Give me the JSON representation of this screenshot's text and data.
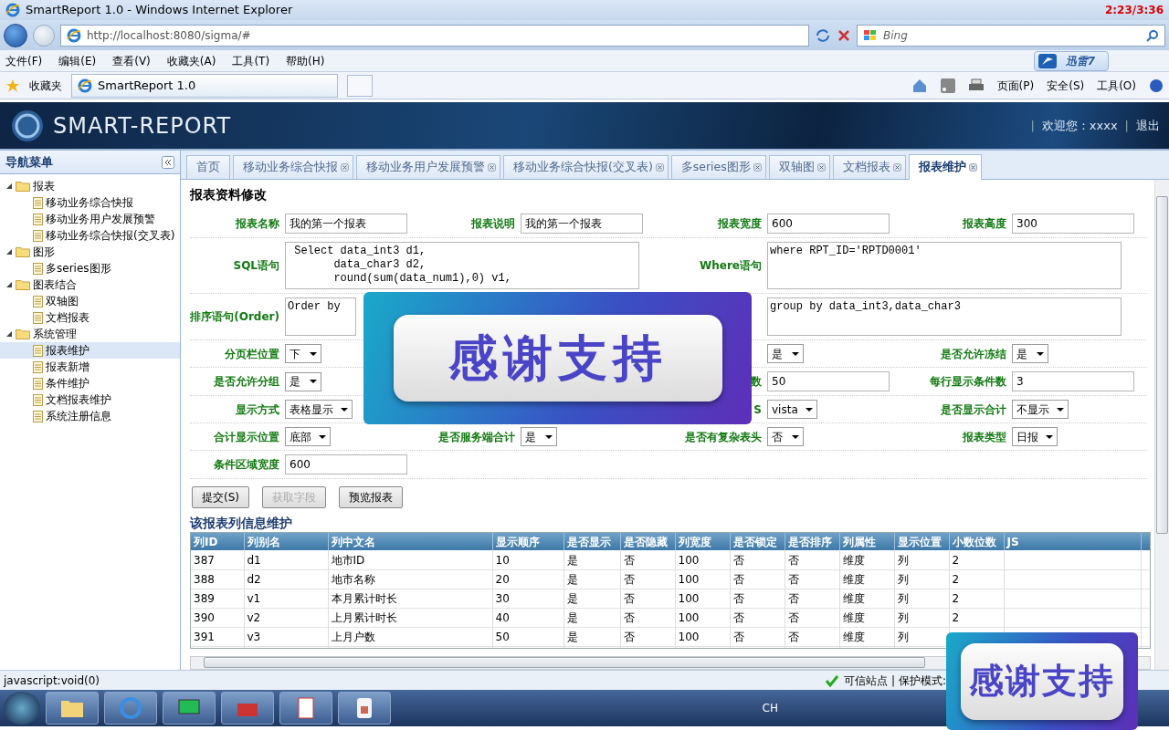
{
  "browser": {
    "title": "SmartReport 1.0 - Windows Internet Explorer",
    "timestamp": "2:23/3:36",
    "address": "http://localhost:8080/sigma/#",
    "search": {
      "placeholder": "Bing"
    },
    "menu": [
      "文件(F)",
      "编辑(E)",
      "查看(V)",
      "收藏夹(A)",
      "工具(T)",
      "帮助(H)"
    ],
    "favorites": "收藏夹",
    "tab": "SmartReport 1.0",
    "addon": "迅雷7",
    "commands": [
      "页面(P)",
      "安全(S)",
      "工具(O)"
    ]
  },
  "app": {
    "logo": "SMART-REPORT",
    "separators": [
      "|",
      "|"
    ],
    "welcome": "欢迎您：xxxx",
    "logout": "退出"
  },
  "sidebar": {
    "title": "导航菜单",
    "items": [
      {
        "label": "报表",
        "kind": "folder",
        "expanded": true,
        "selected": false,
        "children": [
          {
            "label": "移动业务综合快报",
            "kind": "doc",
            "selected": false
          },
          {
            "label": "移动业务用户发展预警",
            "kind": "doc",
            "selected": false
          },
          {
            "label": "移动业务综合快报(交叉表)",
            "kind": "doc",
            "selected": false
          }
        ]
      },
      {
        "label": "图形",
        "kind": "folder",
        "expanded": true,
        "selected": false,
        "children": [
          {
            "label": "多series图形",
            "kind": "doc",
            "selected": false
          }
        ]
      },
      {
        "label": "图表结合",
        "kind": "folder",
        "expanded": true,
        "selected": false,
        "children": [
          {
            "label": "双轴图",
            "kind": "doc",
            "selected": false
          },
          {
            "label": "文档报表",
            "kind": "doc",
            "selected": false
          }
        ]
      },
      {
        "label": "系统管理",
        "kind": "folder",
        "expanded": true,
        "selected": false,
        "children": [
          {
            "label": "报表维护",
            "kind": "doc",
            "selected": true
          },
          {
            "label": "报表新增",
            "kind": "doc",
            "selected": false
          },
          {
            "label": "条件维护",
            "kind": "doc",
            "selected": false
          },
          {
            "label": "文档报表维护",
            "kind": "doc",
            "selected": false
          },
          {
            "label": "系统注册信息",
            "kind": "doc",
            "selected": false
          }
        ]
      }
    ]
  },
  "tabs": [
    {
      "label": "首页",
      "closable": false,
      "selected": false
    },
    {
      "label": "移动业务综合快报",
      "closable": true,
      "selected": false
    },
    {
      "label": "移动业务用户发展预警",
      "closable": true,
      "selected": false
    },
    {
      "label": "移动业务综合快报(交叉表)",
      "closable": true,
      "selected": false
    },
    {
      "label": "多series图形",
      "closable": true,
      "selected": false
    },
    {
      "label": "双轴图",
      "closable": true,
      "selected": false
    },
    {
      "label": "文档报表",
      "closable": true,
      "selected": false
    },
    {
      "label": "报表维护",
      "closable": true,
      "selected": true
    }
  ],
  "form": {
    "title": "报表资料修改",
    "rows": [
      {
        "fields": [
          {
            "label": "报表名称",
            "kind": "text",
            "value": "我的第一个报表"
          },
          {
            "label": "报表说明",
            "kind": "text",
            "value": "我的第一个报表"
          },
          {
            "label": "报表宽度",
            "kind": "text",
            "value": "600"
          },
          {
            "label": "报表高度",
            "kind": "text",
            "value": "300"
          }
        ]
      },
      {
        "fields": [
          {
            "label": "SQL语句",
            "kind": "textarea",
            "value": " Select data_int3 d1,\n       data_char3 d2,\n       round(sum(data_num1),0) v1,"
          },
          {
            "label": "Where语句",
            "kind": "textarea",
            "value": "where RPT_ID='RPTD0001'"
          }
        ]
      },
      {
        "fields": [
          {
            "label": "排序语句(Order)",
            "kind": "textarea",
            "value": "Order by"
          },
          {
            "kind": "textarea",
            "value": "group by data_int3,data_char3"
          }
        ]
      },
      {
        "fields": [
          {
            "label": "分页栏位置",
            "kind": "select",
            "value": "下"
          },
          {
            "kind": "empty"
          },
          {
            "kind": "select",
            "value": "是"
          },
          {
            "label": "是否允许冻结",
            "kind": "select",
            "value": "是"
          }
        ]
      },
      {
        "fields": [
          {
            "label": "是否允许分组",
            "kind": "select",
            "value": "是"
          },
          {
            "kind": "empty"
          },
          {
            "label": "数",
            "kind": "text",
            "value": "50"
          },
          {
            "label": "每行显示条件数",
            "kind": "text",
            "value": "3"
          }
        ]
      },
      {
        "fields": [
          {
            "label": "显示方式",
            "kind": "select",
            "value": "表格显示"
          },
          {
            "kind": "empty"
          },
          {
            "label": "S",
            "kind": "select",
            "value": "vista"
          },
          {
            "label": "是否显示合计",
            "kind": "select",
            "value": "不显示"
          }
        ]
      },
      {
        "fields": [
          {
            "label": "合计显示位置",
            "kind": "select",
            "value": "底部"
          },
          {
            "label": "是否服务端合计",
            "kind": "select",
            "value": "是"
          },
          {
            "label": "是否有复杂表头",
            "kind": "select",
            "value": "否"
          },
          {
            "label": "报表类型",
            "kind": "select",
            "value": "日报"
          }
        ]
      },
      {
        "fields": [
          {
            "label": "条件区域宽度",
            "kind": "text",
            "value": "600"
          }
        ]
      }
    ],
    "buttons": [
      {
        "label": "提交(S)",
        "disabled": false
      },
      {
        "label": "获取字段",
        "disabled": true
      },
      {
        "label": "预览报表",
        "disabled": false
      }
    ]
  },
  "table": {
    "title": "该报表列信息维护",
    "columns": [
      "列ID",
      "列别名",
      "列中文名",
      "显示顺序",
      "是否显示",
      "是否隐藏",
      "列宽度",
      "是否锁定",
      "是否排序",
      "列属性",
      "显示位置",
      "小数位数",
      "JS"
    ],
    "rows": [
      [
        "387",
        "d1",
        "地市ID",
        "10",
        "是",
        "否",
        "100",
        "否",
        "否",
        "维度",
        "列",
        "2",
        null
      ],
      [
        "388",
        "d2",
        "地市名称",
        "20",
        "是",
        "否",
        "100",
        "否",
        "否",
        "维度",
        "列",
        "2",
        null
      ],
      [
        "389",
        "v1",
        "本月累计时长",
        "30",
        "是",
        "否",
        "100",
        "否",
        "否",
        "维度",
        "列",
        "2",
        null
      ],
      [
        "390",
        "v2",
        "上月累计时长",
        "40",
        "是",
        "否",
        "100",
        "否",
        "否",
        "维度",
        "列",
        "2",
        null
      ],
      [
        "391",
        "v3",
        "上月户数",
        "50",
        "是",
        "否",
        "100",
        "否",
        "否",
        "维度",
        "列",
        null,
        null
      ]
    ]
  },
  "status_bar": {
    "text": "javascript:void(0)",
    "zone": "可信站点 | 保护模式:"
  },
  "taskbar": {
    "language": "CH"
  },
  "overlays": [
    {
      "text": "感谢支持"
    },
    {
      "text": "感谢支持"
    }
  ]
}
